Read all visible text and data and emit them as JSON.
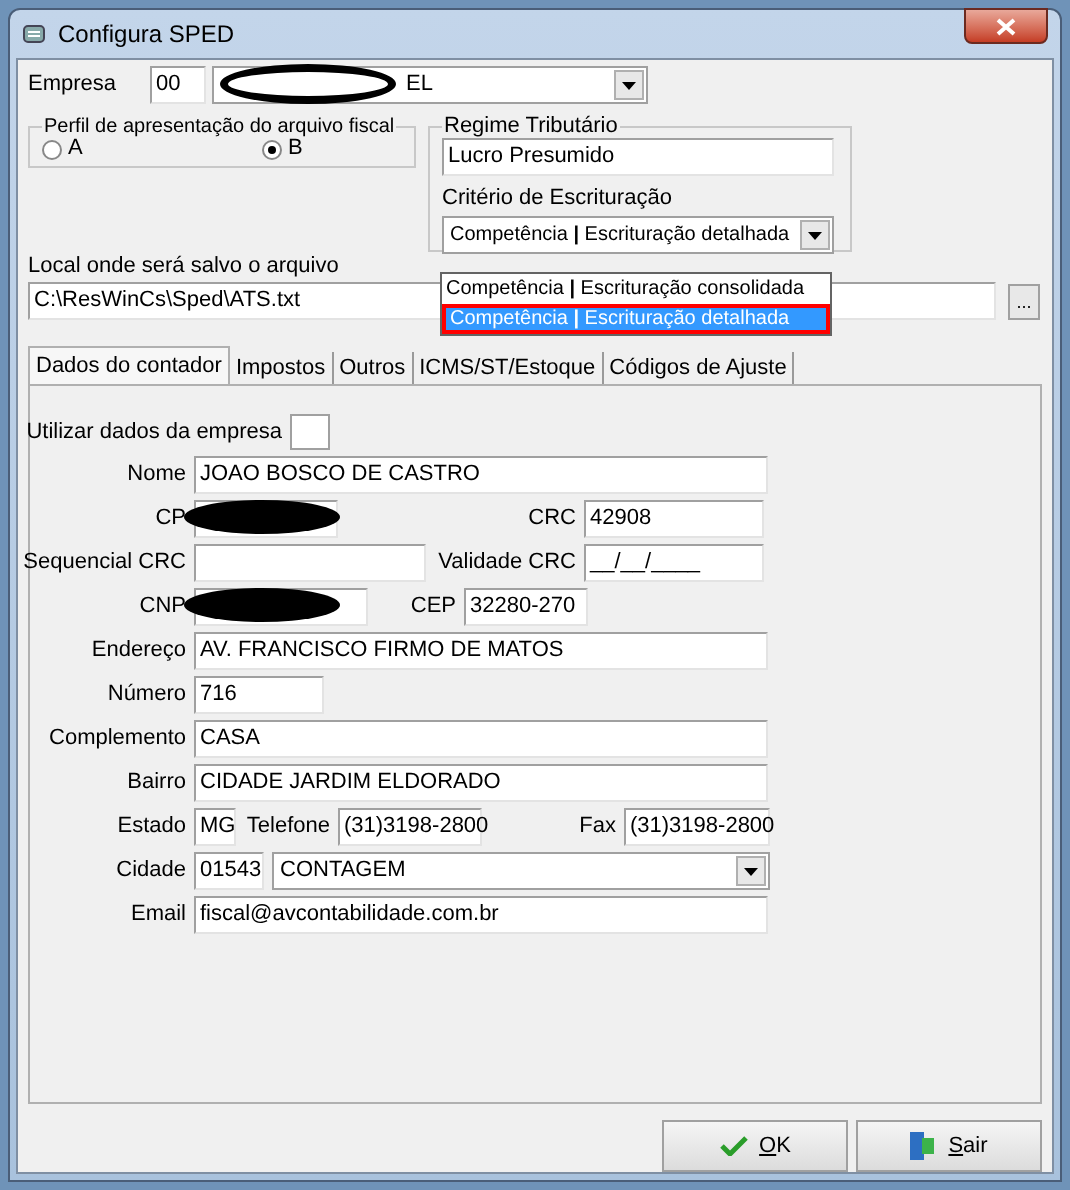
{
  "window": {
    "title": "Configura SPED"
  },
  "empresa": {
    "label": "Empresa",
    "code": "00",
    "name": "EL",
    "redacted": true
  },
  "perfil": {
    "legend": "Perfil de apresentação do arquivo fiscal",
    "options": [
      {
        "label": "A",
        "selected": false
      },
      {
        "label": "B",
        "selected": true
      }
    ]
  },
  "regime": {
    "legend": "Regime Tributário",
    "value": "Lucro Presumido",
    "criterio_label": "Critério de Escrituração",
    "criterio_value": "Competência **|** Escrituração detalhada",
    "expanded": true,
    "options": [
      {
        "label": "Competência **|** Escrituração consolidada",
        "selected": false
      },
      {
        "label": "Competência **|** Escrituração detalhada",
        "selected": true
      }
    ]
  },
  "local": {
    "label": "Local onde será salvo o arquivo",
    "value": "C:\\ResWinCs\\Sped\\ATS.txt",
    "browse": "..."
  },
  "tabs": [
    {
      "label": "Dados do contador",
      "selected": true
    },
    {
      "label": "Impostos",
      "selected": false
    },
    {
      "label": "Outros",
      "selected": false
    },
    {
      "label": "ICMS/ST/Estoque",
      "selected": false
    },
    {
      "label": "Códigos de Ajuste",
      "selected": false
    }
  ],
  "contador": {
    "utilizar": {
      "label": "Utilizar dados da empresa",
      "checked": false
    },
    "nome": {
      "label": "Nome",
      "value": "JOAO BOSCO DE CASTRO"
    },
    "cpf": {
      "label": "CP",
      "redacted": true
    },
    "crc": {
      "label": "CRC",
      "value": "42908"
    },
    "sequencial_crc": {
      "label": "Sequencial CRC"
    },
    "validade_crc": {
      "label": "Validade CRC",
      "value": "__/__/____"
    },
    "cnpj": {
      "label": "CNP",
      "redacted": true
    },
    "cep": {
      "label": "CEP",
      "value": "32280-270"
    },
    "endereco": {
      "label": "Endereço",
      "value": "AV. FRANCISCO FIRMO DE MATOS"
    },
    "numero": {
      "label": "Número",
      "value": "716"
    },
    "complemento": {
      "label": "Complemento",
      "value": "CASA"
    },
    "bairro": {
      "label": "Bairro",
      "value": "CIDADE JARDIM ELDORADO"
    },
    "estado": {
      "label": "Estado",
      "value": "MG"
    },
    "telefone": {
      "label": "Telefone",
      "value": "(31)3198-2800"
    },
    "fax": {
      "label": "Fax",
      "value": "(31)3198-2800"
    },
    "cidade": {
      "label": "Cidade",
      "code": "01543",
      "value": "CONTAGEM"
    },
    "email": {
      "label": "Email",
      "value": "fiscal@avcontabilidade.com.br"
    }
  },
  "buttons": [
    {
      "label": "OK",
      "kind": "ok"
    },
    {
      "label": "Sair",
      "kind": "exit"
    }
  ]
}
